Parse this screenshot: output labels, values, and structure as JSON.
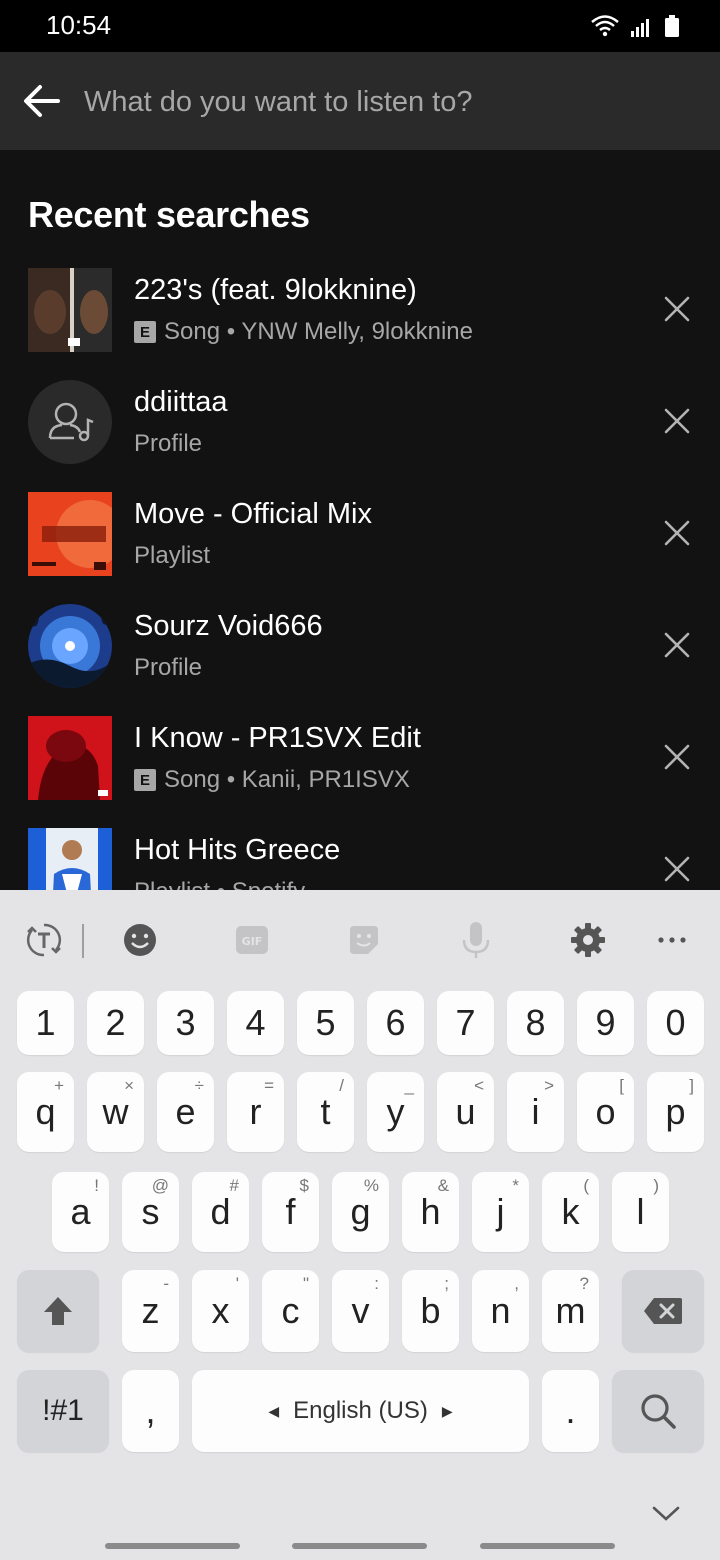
{
  "status": {
    "time": "10:54"
  },
  "search": {
    "placeholder": "What do you want to listen to?"
  },
  "section_title": "Recent searches",
  "results": [
    {
      "title": "223's (feat. 9lokknine)",
      "explicit": true,
      "type": "Song",
      "artists": "YNW Melly, 9lokknine",
      "subtitle": "Song • YNW Melly, 9lokknine"
    },
    {
      "title": "ddiittaa",
      "explicit": false,
      "subtitle": "Profile"
    },
    {
      "title": "Move - Official Mix",
      "explicit": false,
      "subtitle": "Playlist"
    },
    {
      "title": "Sourz Void666",
      "explicit": false,
      "subtitle": "Profile"
    },
    {
      "title": "I Know - PR1SVX Edit",
      "explicit": true,
      "subtitle": "Song • Kanii, PR1ISVX"
    },
    {
      "title": "Hot Hits Greece",
      "explicit": false,
      "subtitle": "Playlist • Spotify"
    }
  ],
  "explicit_badge": "E",
  "keyboard": {
    "numbers": [
      "1",
      "2",
      "3",
      "4",
      "5",
      "6",
      "7",
      "8",
      "9",
      "0"
    ],
    "row1": [
      {
        "k": "q",
        "s": "+"
      },
      {
        "k": "w",
        "s": "×"
      },
      {
        "k": "e",
        "s": "÷"
      },
      {
        "k": "r",
        "s": "="
      },
      {
        "k": "t",
        "s": "/"
      },
      {
        "k": "y",
        "s": "_"
      },
      {
        "k": "u",
        "s": "<"
      },
      {
        "k": "i",
        "s": ">"
      },
      {
        "k": "o",
        "s": "["
      },
      {
        "k": "p",
        "s": "]"
      }
    ],
    "row2": [
      {
        "k": "a",
        "s": "!"
      },
      {
        "k": "s",
        "s": "@"
      },
      {
        "k": "d",
        "s": "#"
      },
      {
        "k": "f",
        "s": "$"
      },
      {
        "k": "g",
        "s": "%"
      },
      {
        "k": "h",
        "s": "&"
      },
      {
        "k": "j",
        "s": "*"
      },
      {
        "k": "k",
        "s": "("
      },
      {
        "k": "l",
        "s": ")"
      }
    ],
    "row3": [
      {
        "k": "z",
        "s": "-"
      },
      {
        "k": "x",
        "s": "'"
      },
      {
        "k": "c",
        "s": "\""
      },
      {
        "k": "v",
        "s": ":"
      },
      {
        "k": "b",
        "s": ";"
      },
      {
        "k": "n",
        "s": ","
      },
      {
        "k": "m",
        "s": "?"
      }
    ],
    "symbols_label": "!#1",
    "comma": ",",
    "space_label": "English (US)",
    "period": "."
  },
  "colors": {
    "background": "#121212",
    "header": "#2a2a2a",
    "subtext": "#a7a7a7",
    "keyboard": "#e4e4e6"
  },
  "icons": [
    "back-arrow-icon",
    "close-icon",
    "translate-icon",
    "emoji-icon",
    "gif-icon",
    "sticker-icon",
    "mic-icon",
    "settings-icon",
    "more-icon",
    "shift-icon",
    "backspace-icon",
    "search-icon",
    "chevron-down-icon",
    "wifi-icon",
    "signal-icon",
    "battery-icon"
  ]
}
